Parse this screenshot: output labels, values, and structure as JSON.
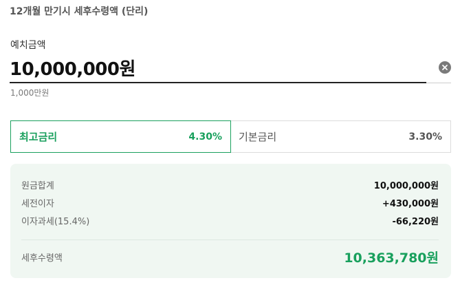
{
  "section_title": "12개월 만기시 세후수령액 (단리)",
  "deposit": {
    "label": "예치금액",
    "value": "10,000,000원",
    "hint": "1,000만원",
    "clear_icon": "clear-circle-icon"
  },
  "rates": {
    "max": {
      "label": "최고금리",
      "value": "4.30%"
    },
    "base": {
      "label": "기본금리",
      "value": "3.30%"
    }
  },
  "summary": {
    "rows": [
      {
        "label": "원금합계",
        "value": "10,000,000원"
      },
      {
        "label": "세전이자",
        "value": "+430,000원"
      },
      {
        "label": "이자과세(15.4%)",
        "value": "-66,220원"
      }
    ],
    "total": {
      "label": "세후수령액",
      "value": "10,363,780원"
    }
  },
  "colors": {
    "accent": "#19a05d",
    "summary_bg": "#f0f7f2"
  }
}
